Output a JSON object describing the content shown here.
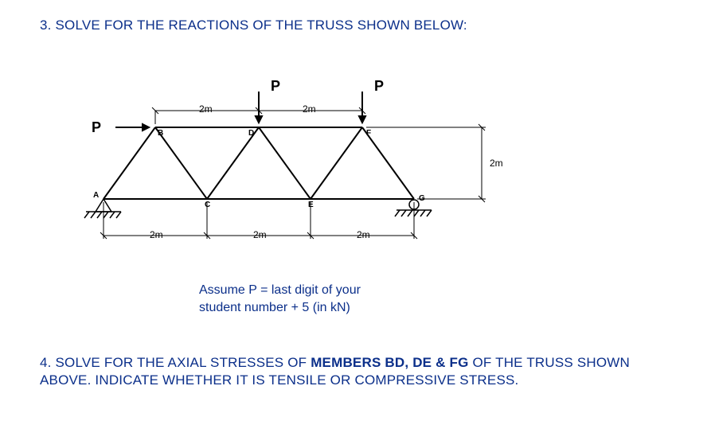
{
  "q3": {
    "heading": "3. SOLVE FOR THE REACTIONS OF THE TRUSS SHOWN BELOW:"
  },
  "diagram": {
    "loads": {
      "P_left": "P",
      "P_topD": "P",
      "P_topF": "P"
    },
    "nodes": {
      "A": "A",
      "B": "B",
      "C": "C",
      "D": "D",
      "E": "E",
      "F": "F",
      "G": "G"
    },
    "dims": {
      "top_BD": "2m",
      "top_DF": "2m",
      "right_h": "2m",
      "bot_AC": "2m",
      "bot_CE": "2m",
      "bot_EG": "2m"
    }
  },
  "note": {
    "line1": "Assume P = last digit of your",
    "line2": "student number + 5 (in kN)"
  },
  "q4": {
    "pre": "4. SOLVE FOR THE AXIAL STRESSES OF ",
    "bold": "MEMBERS BD, DE & FG",
    "post": " OF THE TRUSS SHOWN ABOVE. INDICATE WHETHER IT IS TENSILE OR COMPRESSIVE STRESS."
  }
}
